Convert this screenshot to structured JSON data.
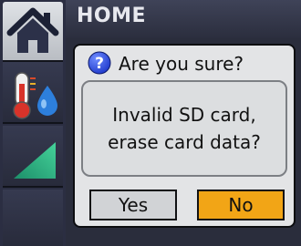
{
  "header": {
    "title": "HOME"
  },
  "sidebar": {
    "tabs": [
      {
        "icon": "home-icon",
        "active": true
      },
      {
        "icon": "thermometer-humidity-icon",
        "active": false
      },
      {
        "icon": "ramp-icon",
        "active": false
      }
    ]
  },
  "dialog": {
    "title": "Are you sure?",
    "icon": "help-icon",
    "message_lines": [
      "Invalid SD card,",
      "erase card data?"
    ],
    "buttons": {
      "yes_label": "Yes",
      "no_label": "No"
    }
  },
  "colors": {
    "no_button": "#f2a516",
    "yes_button": "#d1d3d6",
    "sidebar": "#2b2e42",
    "help_icon": "#1f3fd6"
  }
}
